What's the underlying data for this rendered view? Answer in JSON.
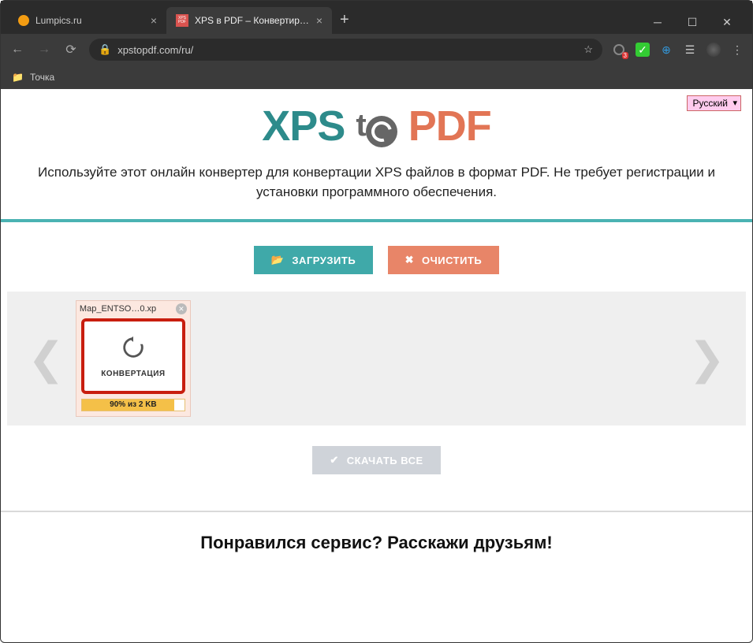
{
  "browser": {
    "tabs": [
      {
        "title": "Lumpics.ru",
        "favicon_color": "#f39c12",
        "active": false
      },
      {
        "title": "XPS в PDF – Конвертировать XP",
        "favicon_text": "XPS\nPDF",
        "active": true
      }
    ],
    "url": "xpstopdf.com/ru/",
    "bookmark": "Точка"
  },
  "language_label": "Русский",
  "logo": {
    "xps": "XPS",
    "t": "t",
    "pdf": "PDF"
  },
  "subheading": "Используйте этот онлайн конвертер для конвертации XPS файлов в формат PDF. Не требует регистрации и установки программного обеспечения.",
  "buttons": {
    "upload": "ЗАГРУЗИТЬ",
    "clear": "ОЧИСТИТЬ",
    "download_all": "СКАЧАТЬ ВСЕ"
  },
  "file": {
    "name": "Map_ENTSO…0.xp",
    "status_label": "КОНВЕРТАЦИЯ",
    "progress_text": "90% из 2 KB",
    "progress_percent": 90
  },
  "share_heading": "Понравился сервис? Расскажи друзьям!"
}
